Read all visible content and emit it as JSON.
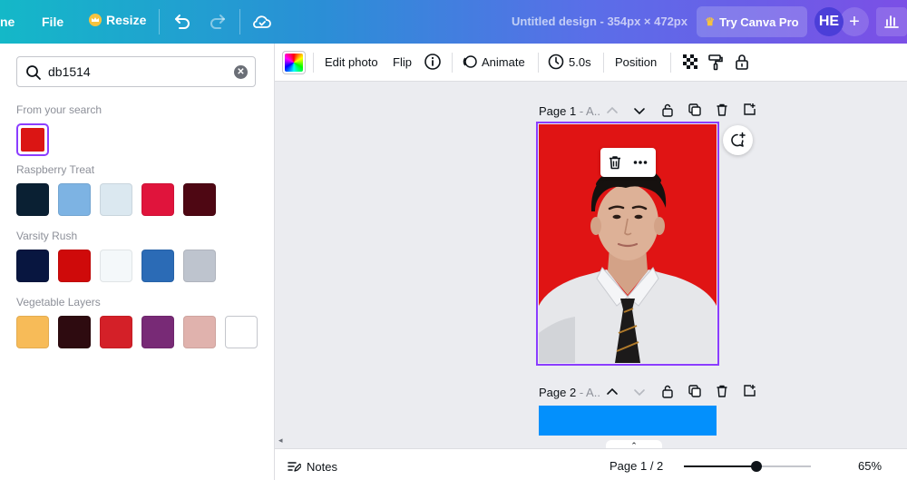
{
  "topbar": {
    "home_label": "ne",
    "file_label": "File",
    "resize_label": "Resize",
    "title": "Untitled design - 354px × 472px",
    "try_pro_label": "Try Canva Pro",
    "avatar_initials": "HE",
    "plus_label": "+"
  },
  "panel": {
    "search": {
      "value": "db1514",
      "placeholder": ""
    },
    "from_search_label": "From your search",
    "from_search_color": "#db1514",
    "palettes": [
      {
        "name": "Raspberry Treat",
        "colors": [
          "#0a2033",
          "#7db3e3",
          "#dbe8f0",
          "#e0143c",
          "#4e0713"
        ]
      },
      {
        "name": "Varsity Rush",
        "colors": [
          "#081640",
          "#cf0a0a",
          "#f4f8fa",
          "#2b6bb6",
          "#bec4ce"
        ]
      },
      {
        "name": "Vegetable Layers",
        "colors": [
          "#f7bb58",
          "#2e0b10",
          "#d42028",
          "#782a76",
          "#e0b2ad",
          "#ffffff"
        ]
      }
    ]
  },
  "toolbar": {
    "edit_photo": "Edit photo",
    "flip": "Flip",
    "animate": "Animate",
    "duration": "5.0s",
    "position": "Position"
  },
  "canvas": {
    "page1": {
      "title": "Page 1",
      "suffix": "- A..",
      "background": "#e01414"
    },
    "page2": {
      "title": "Page 2",
      "suffix": "- A..",
      "background": "#0390fc"
    }
  },
  "bottombar": {
    "notes_label": "Notes",
    "page_indicator": "Page 1 / 2",
    "zoom_label": "65%",
    "zoom_fraction": 0.57
  }
}
